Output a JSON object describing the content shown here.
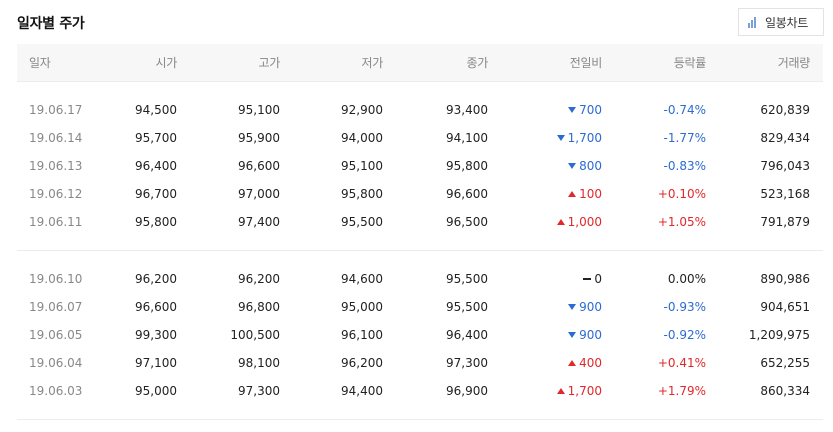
{
  "title": "일자별 주가",
  "chart_button": {
    "label": "일봉차트",
    "icon": "bar-chart-icon"
  },
  "columns": [
    "일자",
    "시가",
    "고가",
    "저가",
    "종가",
    "전일비",
    "등락률",
    "거래량"
  ],
  "colors": {
    "up": "#e1282b",
    "down": "#2c6bd1",
    "flat": "#222222"
  },
  "groups": [
    [
      {
        "date": "19.06.17",
        "open": "94,500",
        "high": "95,100",
        "low": "92,900",
        "close": "93,400",
        "dir": "down",
        "diff": "700",
        "rate": "-0.74%",
        "volume": "620,839"
      },
      {
        "date": "19.06.14",
        "open": "95,700",
        "high": "95,900",
        "low": "94,000",
        "close": "94,100",
        "dir": "down",
        "diff": "1,700",
        "rate": "-1.77%",
        "volume": "829,434"
      },
      {
        "date": "19.06.13",
        "open": "96,400",
        "high": "96,600",
        "low": "95,100",
        "close": "95,800",
        "dir": "down",
        "diff": "800",
        "rate": "-0.83%",
        "volume": "796,043"
      },
      {
        "date": "19.06.12",
        "open": "96,700",
        "high": "97,000",
        "low": "95,800",
        "close": "96,600",
        "dir": "up",
        "diff": "100",
        "rate": "+0.10%",
        "volume": "523,168"
      },
      {
        "date": "19.06.11",
        "open": "95,800",
        "high": "97,400",
        "low": "95,500",
        "close": "96,500",
        "dir": "up",
        "diff": "1,000",
        "rate": "+1.05%",
        "volume": "791,879"
      }
    ],
    [
      {
        "date": "19.06.10",
        "open": "96,200",
        "high": "96,200",
        "low": "94,600",
        "close": "95,500",
        "dir": "flat",
        "diff": "0",
        "rate": "0.00%",
        "volume": "890,986"
      },
      {
        "date": "19.06.07",
        "open": "96,600",
        "high": "96,800",
        "low": "95,000",
        "close": "95,500",
        "dir": "down",
        "diff": "900",
        "rate": "-0.93%",
        "volume": "904,651"
      },
      {
        "date": "19.06.05",
        "open": "99,300",
        "high": "100,500",
        "low": "96,100",
        "close": "96,400",
        "dir": "down",
        "diff": "900",
        "rate": "-0.92%",
        "volume": "1,209,975"
      },
      {
        "date": "19.06.04",
        "open": "97,100",
        "high": "98,100",
        "low": "96,200",
        "close": "97,300",
        "dir": "up",
        "diff": "400",
        "rate": "+0.41%",
        "volume": "652,255"
      },
      {
        "date": "19.06.03",
        "open": "95,000",
        "high": "97,300",
        "low": "94,400",
        "close": "96,900",
        "dir": "up",
        "diff": "1,700",
        "rate": "+1.79%",
        "volume": "860,334"
      }
    ]
  ]
}
